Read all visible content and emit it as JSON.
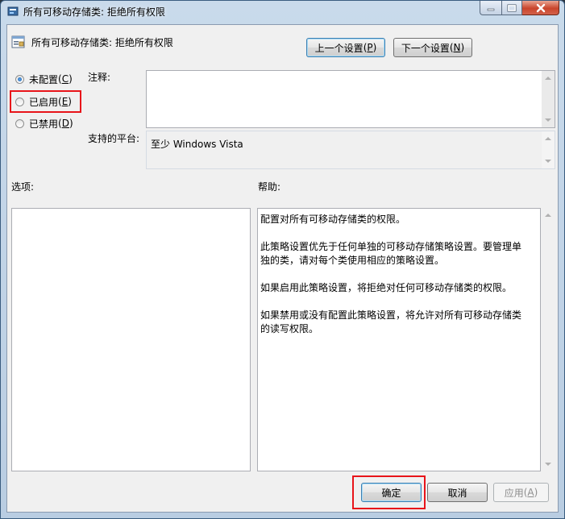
{
  "window": {
    "title": "所有可移动存储类: 拒绝所有权限",
    "colors": {
      "title_bar": "#c9daeb",
      "client_bg": "#f0f0f0",
      "highlight": "#e8141a",
      "close_button": "#c9452c"
    }
  },
  "header": {
    "setting_name": "所有可移动存储类: 拒绝所有权限",
    "prev_button": {
      "label": "上一个设置",
      "hotkey": "P"
    },
    "next_button": {
      "label": "下一个设置",
      "hotkey": "N"
    }
  },
  "state_options": [
    {
      "label": "未配置",
      "hotkey": "C",
      "checked": true
    },
    {
      "label": "已启用",
      "hotkey": "E",
      "checked": false
    },
    {
      "label": "已禁用",
      "hotkey": "D",
      "checked": false
    }
  ],
  "comment": {
    "label": "注释:",
    "value": ""
  },
  "platform": {
    "label": "支持的平台:",
    "value": "至少 Windows Vista"
  },
  "options_label": "选项:",
  "help_label": "帮助:",
  "help_paragraphs": [
    "配置对所有可移动存储类的权限。",
    "此策略设置优先于任何单独的可移动存储策略设置。要管理单独的类，请对每个类使用相应的策略设置。",
    "如果启用此策略设置，将拒绝对任何可移动存储类的权限。",
    "如果禁用或没有配置此策略设置，将允许对所有可移动存储类的读写权限。"
  ],
  "footer": {
    "ok": {
      "label": "确定"
    },
    "cancel": {
      "label": "取消"
    },
    "apply": {
      "label": "应用",
      "hotkey": "A"
    }
  }
}
